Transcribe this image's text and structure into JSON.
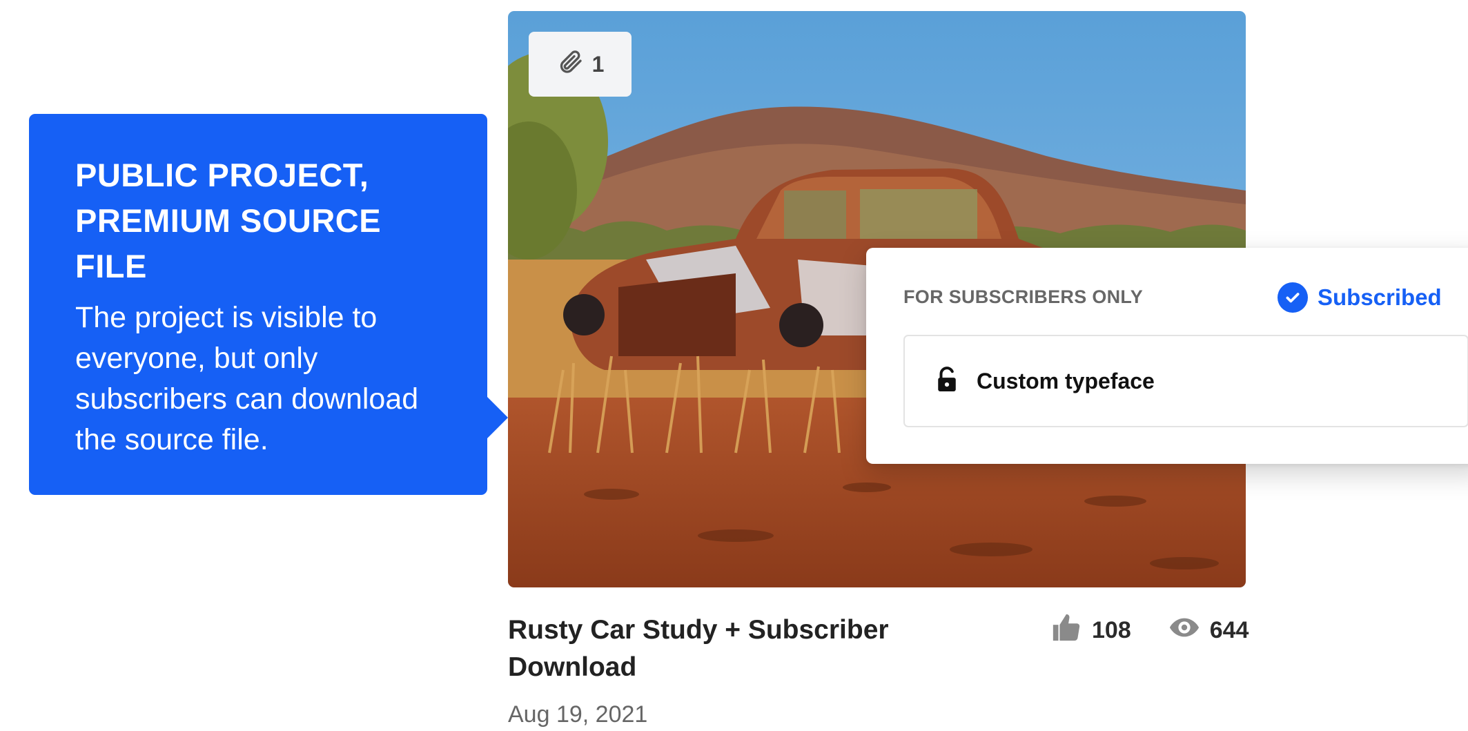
{
  "callout": {
    "title": "PUBLIC PROJECT, PREMIUM SOURCE FILE",
    "body": "The project is visible to everyone, but only subscribers can download the source file."
  },
  "thumbnail": {
    "attachments": "1",
    "alt": "painting of an abandoned rusty car in desert grass"
  },
  "popover": {
    "label": "FOR SUBSCRIBERS ONLY",
    "status": "Subscribed",
    "file_name": "Custom typeface"
  },
  "project": {
    "title": "Rusty Car Study + Subscriber Download",
    "likes": "108",
    "views": "644",
    "date": "Aug 19, 2021"
  },
  "colors": {
    "accent": "#1660f5"
  },
  "icons": [
    "paperclip-icon",
    "check-circle-icon",
    "unlock-icon",
    "thumbs-up-icon",
    "eye-icon"
  ]
}
